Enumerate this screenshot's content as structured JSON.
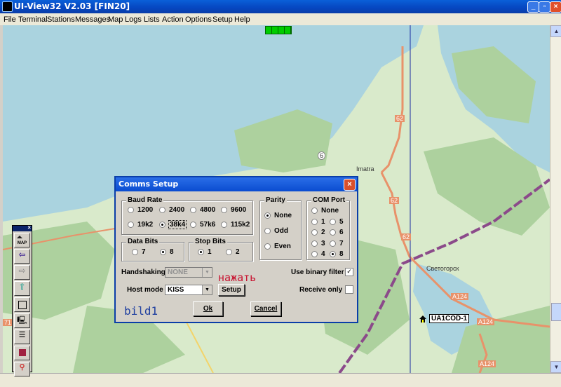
{
  "window": {
    "title": "UI-View32 V2.03 [FIN20]"
  },
  "menu": [
    "File",
    "Terminal",
    "Stations",
    "Messages",
    "Map",
    "Logs",
    "Lists",
    "Action",
    "Options",
    "Setup",
    "Help"
  ],
  "map": {
    "labels": {
      "imatra": "Imatra",
      "svetogorsk": "Светогорск",
      "road_62a": "62",
      "road_62b": "62",
      "road_62c": "62",
      "road_6": "6",
      "road_a124a": "A124",
      "road_a124b": "A124",
      "road_a124c": "A124",
      "road_71": "71"
    },
    "station": "UA1COD-1",
    "icons": {
      "station": "home-icon"
    }
  },
  "toolbar": {
    "icons": [
      "map-icon",
      "back-arrow-icon",
      "forward-arrow-icon",
      "up-arrow-icon",
      "square-icon",
      "terminal-icon",
      "list-icon",
      "book-icon",
      "antenna-icon"
    ],
    "map_button_label": "MAP"
  },
  "dialog": {
    "title": "Comms Setup",
    "baud": {
      "label": "Baud Rate",
      "options": [
        "1200",
        "2400",
        "4800",
        "9600",
        "19k2",
        "38k4",
        "57k6",
        "115k2"
      ],
      "selected": "38k4"
    },
    "parity": {
      "label": "Parity",
      "options": [
        "None",
        "Odd",
        "Even"
      ],
      "selected": "None"
    },
    "com": {
      "label": "COM Port",
      "options": [
        "None",
        "1",
        "5",
        "2",
        "6",
        "3",
        "7",
        "4",
        "8"
      ],
      "selected": "8"
    },
    "databits": {
      "label": "Data Bits",
      "options": [
        "7",
        "8"
      ],
      "selected": "8"
    },
    "stopbits": {
      "label": "Stop Bits",
      "options": [
        "1",
        "2"
      ],
      "selected": "1"
    },
    "handshaking": {
      "label": "Handshaking",
      "value": "NONE"
    },
    "hostmode": {
      "label": "Host mode",
      "value": "KISS"
    },
    "setup_button": "Setup",
    "use_binary_filter": {
      "label": "Use binary filter",
      "checked": true
    },
    "receive_only": {
      "label": "Receive only",
      "checked": false
    },
    "ok": "Ok",
    "cancel": "Cancel"
  },
  "annotations": {
    "press": "нажать",
    "bild": "bild1"
  }
}
